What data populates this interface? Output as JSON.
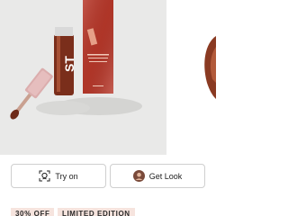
{
  "product_image": {
    "alt_semantic": "lip-gloss-product-photo",
    "accent_colors": {
      "gloss": "#8a3a22",
      "box": "#b8382a",
      "cap": "#c98a8a",
      "background": "#e9e9e8"
    }
  },
  "actions": {
    "try_on_label": "Try on",
    "try_on_icon": "face-scan-icon",
    "get_look_label": "Get Look",
    "get_look_icon": "avatar-icon"
  },
  "badges": {
    "discount": "30% OFF",
    "edition": "LIMITED EDITION"
  }
}
